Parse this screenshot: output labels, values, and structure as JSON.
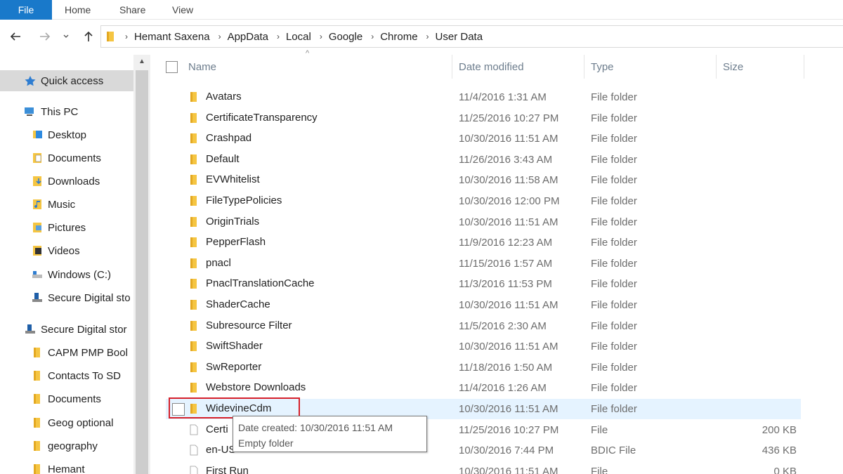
{
  "ribbon": {
    "file": "File",
    "home": "Home",
    "share": "Share",
    "view": "View"
  },
  "breadcrumb": [
    "Hemant Saxena",
    "AppData",
    "Local",
    "Google",
    "Chrome",
    "User Data"
  ],
  "nav": {
    "quick_access": "Quick access",
    "this_pc": "This PC",
    "desktop": "Desktop",
    "documents": "Documents",
    "downloads": "Downloads",
    "music": "Music",
    "pictures": "Pictures",
    "videos": "Videos",
    "windows_c": "Windows (C:)",
    "secure_digital_sub": "Secure Digital sto",
    "secure_digital": "Secure Digital stor",
    "capm": "CAPM PMP Bool",
    "contacts": "Contacts To SD",
    "documents2": "Documents",
    "geog": "Geog optional",
    "geography": "geography",
    "hemant": "Hemant"
  },
  "columns": {
    "name": "Name",
    "date": "Date modified",
    "type": "Type",
    "size": "Size"
  },
  "files": [
    {
      "name": "Avatars",
      "date": "11/4/2016 1:31 AM",
      "type": "File folder",
      "size": "",
      "icon": "folder"
    },
    {
      "name": "CertificateTransparency",
      "date": "11/25/2016 10:27 PM",
      "type": "File folder",
      "size": "",
      "icon": "folder"
    },
    {
      "name": "Crashpad",
      "date": "10/30/2016 11:51 AM",
      "type": "File folder",
      "size": "",
      "icon": "folder"
    },
    {
      "name": "Default",
      "date": "11/26/2016 3:43 AM",
      "type": "File folder",
      "size": "",
      "icon": "folder"
    },
    {
      "name": "EVWhitelist",
      "date": "10/30/2016 11:58 AM",
      "type": "File folder",
      "size": "",
      "icon": "folder"
    },
    {
      "name": "FileTypePolicies",
      "date": "10/30/2016 12:00 PM",
      "type": "File folder",
      "size": "",
      "icon": "folder"
    },
    {
      "name": "OriginTrials",
      "date": "10/30/2016 11:51 AM",
      "type": "File folder",
      "size": "",
      "icon": "folder"
    },
    {
      "name": "PepperFlash",
      "date": "11/9/2016 12:23 AM",
      "type": "File folder",
      "size": "",
      "icon": "folder"
    },
    {
      "name": "pnacl",
      "date": "11/15/2016 1:57 AM",
      "type": "File folder",
      "size": "",
      "icon": "folder"
    },
    {
      "name": "PnaclTranslationCache",
      "date": "11/3/2016 11:53 PM",
      "type": "File folder",
      "size": "",
      "icon": "folder"
    },
    {
      "name": "ShaderCache",
      "date": "10/30/2016 11:51 AM",
      "type": "File folder",
      "size": "",
      "icon": "folder"
    },
    {
      "name": "Subresource Filter",
      "date": "11/5/2016 2:30 AM",
      "type": "File folder",
      "size": "",
      "icon": "folder"
    },
    {
      "name": "SwiftShader",
      "date": "10/30/2016 11:51 AM",
      "type": "File folder",
      "size": "",
      "icon": "folder"
    },
    {
      "name": "SwReporter",
      "date": "11/18/2016 1:50 AM",
      "type": "File folder",
      "size": "",
      "icon": "folder"
    },
    {
      "name": "Webstore Downloads",
      "date": "11/4/2016 1:26 AM",
      "type": "File folder",
      "size": "",
      "icon": "folder"
    },
    {
      "name": "WidevineCdm",
      "date": "10/30/2016 11:51 AM",
      "type": "File folder",
      "size": "",
      "icon": "folder"
    },
    {
      "name": "Certi",
      "date": "11/25/2016 10:27 PM",
      "type": "File",
      "size": "200 KB",
      "icon": "file"
    },
    {
      "name": "en-US",
      "date": "10/30/2016 7:44 PM",
      "type": "BDIC File",
      "size": "436 KB",
      "icon": "file"
    },
    {
      "name": "First Run",
      "date": "10/30/2016 11:51 AM",
      "type": "File",
      "size": "0 KB",
      "icon": "file"
    }
  ],
  "tooltip": {
    "line1": "Date created: 10/30/2016 11:51 AM",
    "line2": "Empty folder"
  },
  "colors": {
    "accent": "#1979ca",
    "folder": "#f5c542",
    "highlight": "#e5f3ff",
    "redbox": "#d6202a"
  }
}
